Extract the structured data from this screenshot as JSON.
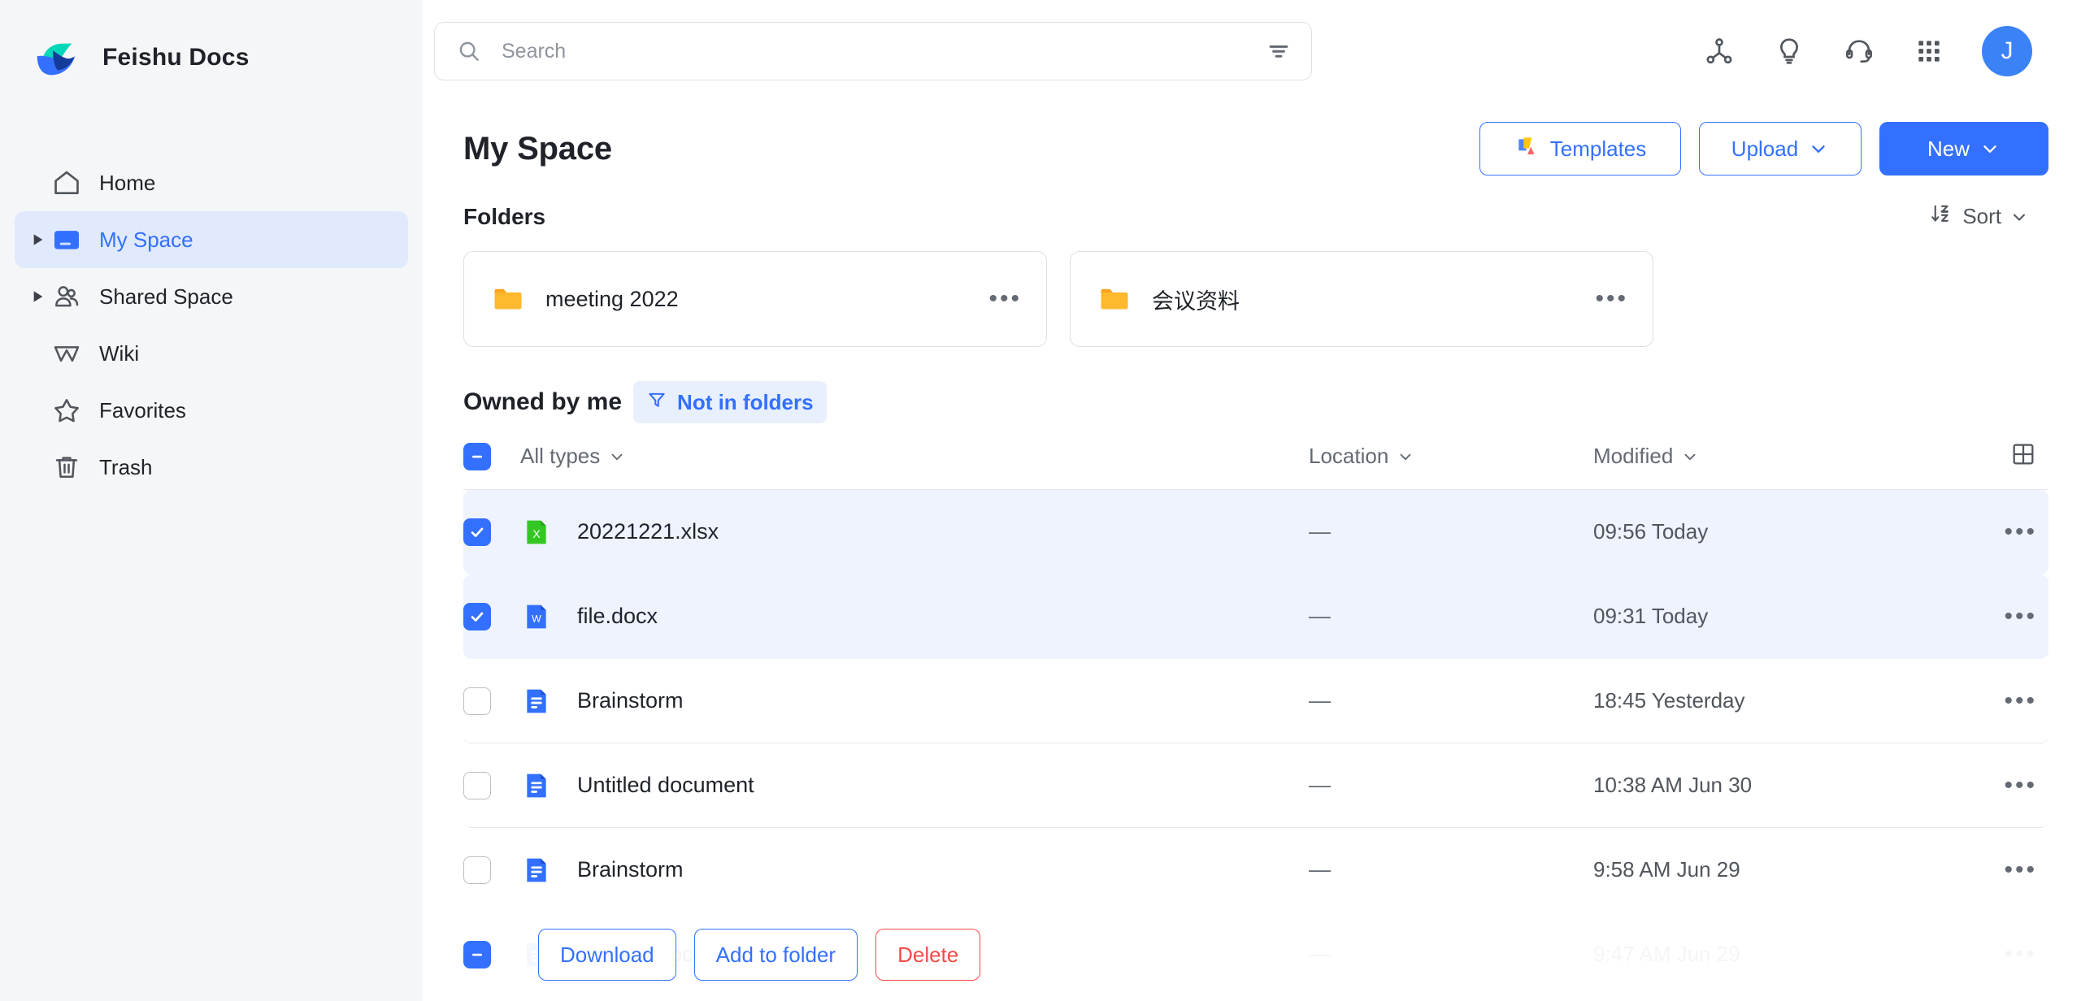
{
  "brand": {
    "name": "Feishu Docs"
  },
  "sidebar": {
    "items": [
      {
        "label": "Home",
        "icon": "home-icon",
        "expandable": false,
        "active": false
      },
      {
        "label": "My Space",
        "icon": "folder-icon",
        "expandable": true,
        "active": true
      },
      {
        "label": "Shared Space",
        "icon": "people-icon",
        "expandable": true,
        "active": false
      },
      {
        "label": "Wiki",
        "icon": "wiki-icon",
        "expandable": false,
        "active": false
      },
      {
        "label": "Favorites",
        "icon": "star-icon",
        "expandable": false,
        "active": false
      },
      {
        "label": "Trash",
        "icon": "trash-icon",
        "expandable": false,
        "active": false
      }
    ]
  },
  "topbar": {
    "search": {
      "placeholder": "Search",
      "value": ""
    },
    "icons": [
      "share-network-icon",
      "lightbulb-icon",
      "headset-icon",
      "apps-grid-icon"
    ],
    "avatar_initial": "J"
  },
  "page": {
    "title": "My Space",
    "actions": {
      "templates": "Templates",
      "upload": "Upload",
      "new": "New"
    }
  },
  "folders_section": {
    "title": "Folders",
    "sort_label": "Sort",
    "items": [
      {
        "name": "meeting 2022"
      },
      {
        "name": "会议资料"
      }
    ]
  },
  "owned": {
    "title": "Owned by me",
    "filter_chip": "Not in folders"
  },
  "table": {
    "headers": {
      "types": "All types",
      "location": "Location",
      "modified": "Modified"
    },
    "select_all_state": "indeterminate",
    "rows": [
      {
        "name": "20221221.xlsx",
        "type": "xlsx",
        "badge": "X",
        "location": "—",
        "modified": "09:56 Today",
        "selected": true
      },
      {
        "name": "file.docx",
        "type": "docx",
        "badge": "W",
        "location": "—",
        "modified": "09:31 Today",
        "selected": true
      },
      {
        "name": "Brainstorm",
        "type": "doc",
        "badge": "",
        "location": "—",
        "modified": "18:45 Yesterday",
        "selected": false
      },
      {
        "name": "Untitled document",
        "type": "doc",
        "badge": "",
        "location": "—",
        "modified": "10:38 AM Jun 30",
        "selected": false
      },
      {
        "name": "Brainstorm",
        "type": "doc",
        "badge": "",
        "location": "—",
        "modified": "9:58 AM Jun 29",
        "selected": false
      },
      {
        "name": "Untitled document",
        "type": "doc",
        "badge": "",
        "location": "—",
        "modified": "9:47 AM Jun 29",
        "selected": false
      }
    ]
  },
  "action_bar": {
    "download": "Download",
    "add_to_folder": "Add to folder",
    "delete": "Delete"
  },
  "colors": {
    "accent": "#3370ff",
    "danger": "#f54a45",
    "selected_row": "#eff3fd",
    "sidebar_bg": "#f5f6f7",
    "folder_yellow": "#ffb92e",
    "excel_green": "#34c724",
    "doc_blue": "#3370ff"
  }
}
